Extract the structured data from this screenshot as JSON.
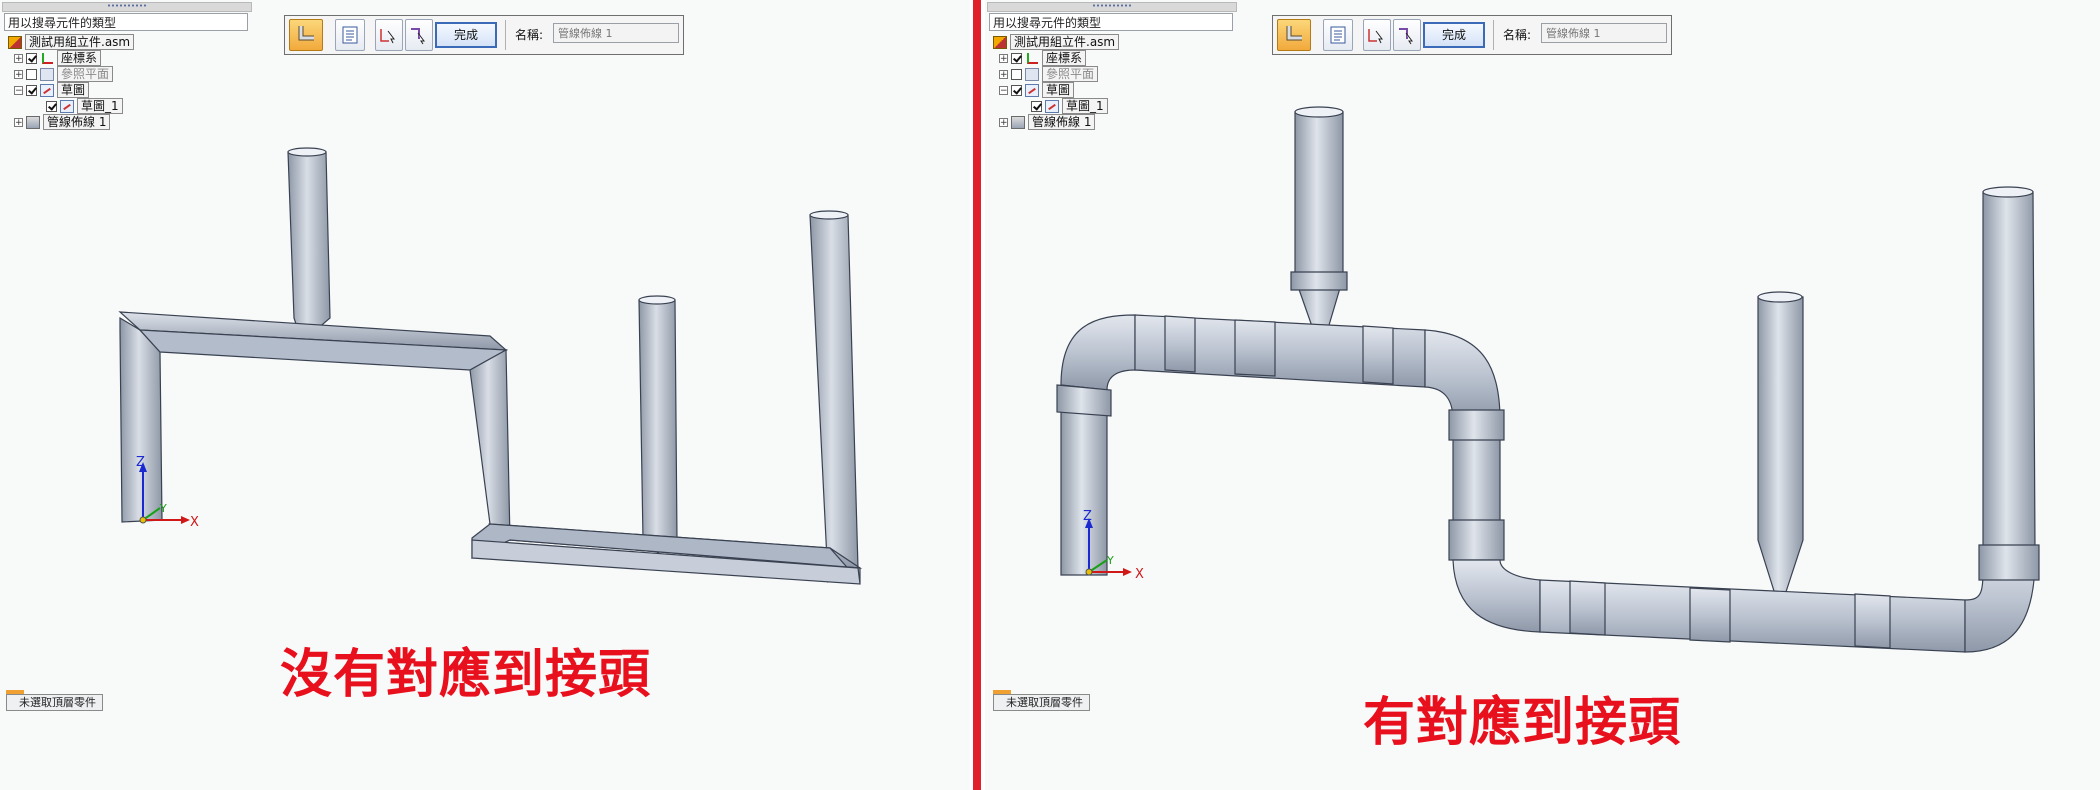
{
  "left": {
    "filter_text": "用以搜尋元件的類型",
    "tree": [
      {
        "label": "測試用組立件.asm",
        "icon": "assembly-icon"
      },
      {
        "label": "座標系",
        "icon": "coordinate-system-icon"
      },
      {
        "label": "參照平面",
        "icon": "reference-plane-icon"
      },
      {
        "label": "草圖",
        "icon": "sketch-icon"
      },
      {
        "label": "草圖_1",
        "icon": "sketch-icon"
      },
      {
        "label": "管線佈線 1",
        "icon": "pipe-routing-icon"
      }
    ],
    "command_bar": {
      "done_label": "完成",
      "name_label": "名稱:",
      "name_value": "管線佈線 1"
    },
    "status_button": "未選取頂層零件",
    "axis": {
      "z": "Z",
      "y": "Y",
      "x": "X"
    },
    "caption": "沒有對應到接頭"
  },
  "right": {
    "filter_text": "用以搜尋元件的類型",
    "tree": [
      {
        "label": "測試用組立件.asm",
        "icon": "assembly-icon"
      },
      {
        "label": "座標系",
        "icon": "coordinate-system-icon"
      },
      {
        "label": "參照平面",
        "icon": "reference-plane-icon"
      },
      {
        "label": "草圖",
        "icon": "sketch-icon"
      },
      {
        "label": "草圖_1",
        "icon": "sketch-icon"
      },
      {
        "label": "管線佈線 1",
        "icon": "pipe-routing-icon"
      }
    ],
    "command_bar": {
      "done_label": "完成",
      "name_label": "名稱:",
      "name_value": "管線佈線 1"
    },
    "status_button": "未選取頂層零件",
    "axis": {
      "z": "Z",
      "y": "Y",
      "x": "X"
    },
    "caption": "有對應到接頭"
  },
  "colors": {
    "accent": "#e0202a",
    "pipe_fill": "#b9c2cf",
    "pipe_edge": "#3a4252"
  }
}
